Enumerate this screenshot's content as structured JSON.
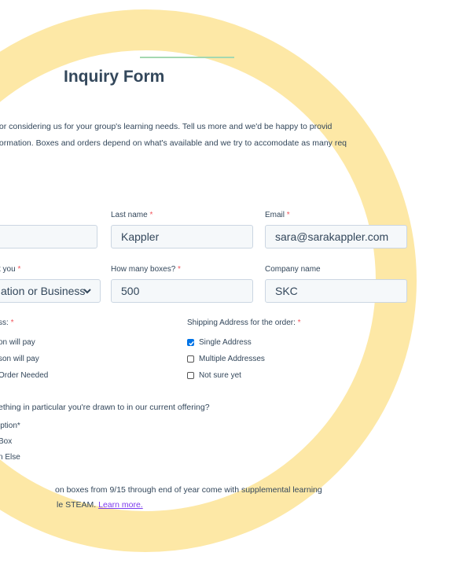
{
  "form": {
    "title": "Inquiry Form",
    "intro_line1": "for considering us for your group's learning needs.  Tell us more and we'd be happy to provid",
    "intro_line2": "formation.  Boxes and orders depend on what's available and we try to accomodate as many req"
  },
  "fields": {
    "last_name": {
      "label": "Last name",
      "value": "Kappler"
    },
    "email": {
      "label": "Email",
      "value": "sara@sarakappler.com"
    },
    "about_you": {
      "label": "t you",
      "value": "ation or Business"
    },
    "boxes": {
      "label": "How many boxes?",
      "value": "500"
    },
    "company": {
      "label": "Company name",
      "value": "SKC"
    }
  },
  "payment": {
    "label": "ss:",
    "options": [
      "on will pay",
      "son will pay",
      "Order Needed"
    ]
  },
  "shipping": {
    "label": "Shipping Address for the order:",
    "options": [
      {
        "label": "Single Address",
        "checked": true
      },
      {
        "label": "Multiple Addresses",
        "checked": false
      },
      {
        "label": "Not sure yet",
        "checked": false
      }
    ]
  },
  "drawn": {
    "question": "ething in particular you're drawn to in our current offering?",
    "options": [
      "iption*",
      "Box",
      "n Else"
    ]
  },
  "footer": {
    "line1": "on boxes from 9/15 through end of year come with supplemental learning",
    "line2_prefix": "le STEAM.",
    "link": "Learn more."
  },
  "required_mark": "*",
  "colors": {
    "ring": "#fde8a6",
    "accent_link": "#7c3aed",
    "required": "#f2545b",
    "checkbox": "#0073e6"
  }
}
